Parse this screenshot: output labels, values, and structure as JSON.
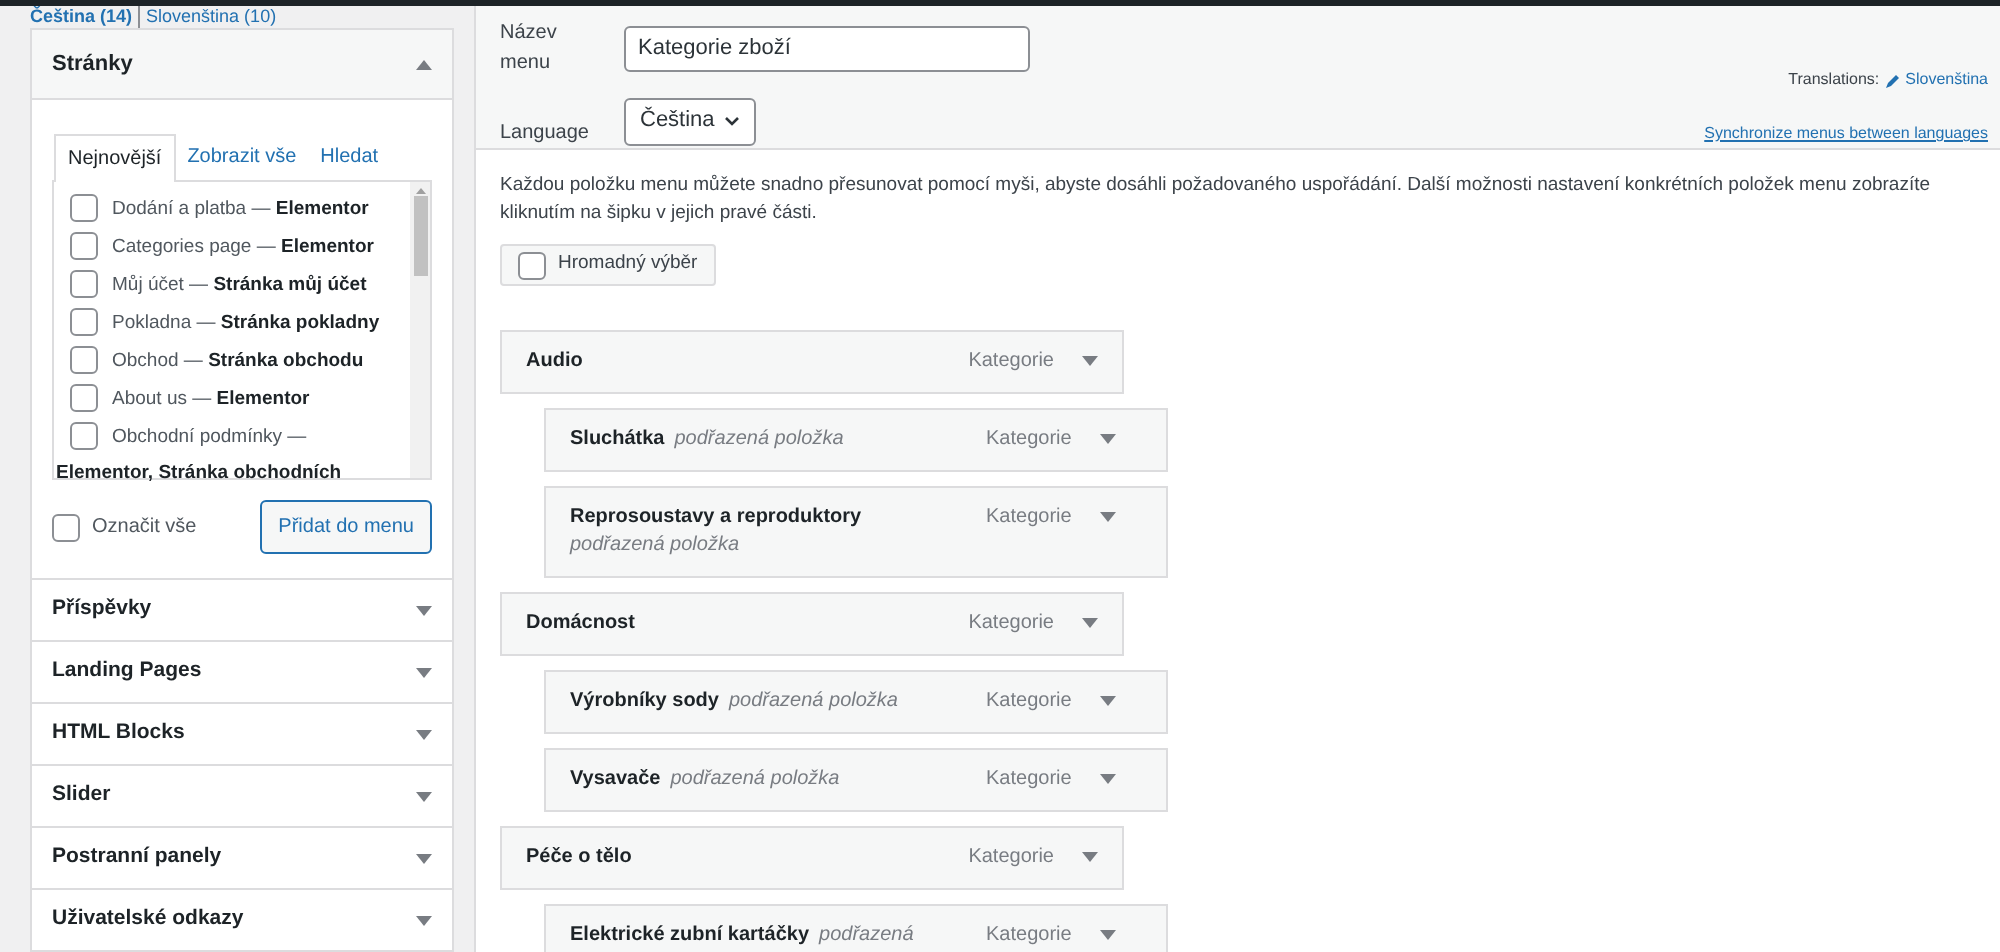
{
  "languages": [
    {
      "label": "Čeština (14)",
      "selected": true
    },
    {
      "label": "Slovenština (10)",
      "selected": false
    }
  ],
  "pages_box": {
    "title": "Stránky",
    "expanded": true,
    "tabs": [
      {
        "label": "Nejnovější",
        "selected": true
      },
      {
        "label": "Zobrazit vše",
        "selected": false
      },
      {
        "label": "Hledat",
        "selected": false
      }
    ],
    "items": [
      {
        "name": "Dodání a platba —",
        "note": "Elementor",
        "checked": false
      },
      {
        "name": "Categories page —",
        "note": "Elementor",
        "checked": false
      },
      {
        "name": "Můj účet —",
        "note": "Stránka můj účet",
        "checked": false
      },
      {
        "name": "Pokladna —",
        "note": "Stránka pokladny",
        "checked": false
      },
      {
        "name": "Obchod —",
        "note": "Stránka obchodu",
        "checked": false
      },
      {
        "name": "About us —",
        "note": "Elementor",
        "checked": false
      },
      {
        "name": "Obchodní podmínky —",
        "checked": false
      }
    ],
    "overflow_line": "Elementor, Stránka obchodních",
    "select_all": {
      "label": "Označit vše",
      "checked": false
    },
    "add_button": "Přidat do menu"
  },
  "sections": [
    {
      "title": "Příspěvky",
      "expanded": false
    },
    {
      "title": "Landing Pages",
      "expanded": false
    },
    {
      "title": "HTML Blocks",
      "expanded": false
    },
    {
      "title": "Slider",
      "expanded": false
    },
    {
      "title": "Postranní panely",
      "expanded": false
    },
    {
      "title": "Uživatelské odkazy",
      "expanded": false
    }
  ],
  "menu_name": {
    "label": "Název menu",
    "value": "Kategorie zboží"
  },
  "language": {
    "label": "Language",
    "value": "Čeština"
  },
  "translations": {
    "label": "Translations:",
    "link": "Slovenština"
  },
  "sync_link": "Synchronize menus between languages",
  "instructions": "Každou položku menu můžete snadno přesunovat pomocí myši, abyste dosáhli požadovaného uspořádání. Další možnosti nastavení konkrétních položek menu zobrazíte kliknutím na šipku v jejich pravé části.",
  "bulk_select": {
    "label": "Hromadný výběr",
    "checked": false
  },
  "menu_items": [
    {
      "title": "Audio",
      "type": "Kategorie",
      "children": [
        {
          "title": "Sluchátka",
          "sub": "podřazená položka",
          "type": "Kategorie"
        },
        {
          "title": "Reprosoustavy a reproduktory",
          "sub": "podřazená položka",
          "type": "Kategorie"
        }
      ]
    },
    {
      "title": "Domácnost",
      "type": "Kategorie",
      "children": [
        {
          "title": "Výrobníky sody",
          "sub": "podřazená položka",
          "type": "Kategorie"
        },
        {
          "title": "Vysavače",
          "sub": "podřazená položka",
          "type": "Kategorie"
        }
      ]
    },
    {
      "title": "Péče o tělo",
      "type": "Kategorie",
      "children": [
        {
          "title": "Elektrické zubní kartáčky",
          "sub": "podřazená",
          "type": "Kategorie"
        }
      ]
    }
  ]
}
